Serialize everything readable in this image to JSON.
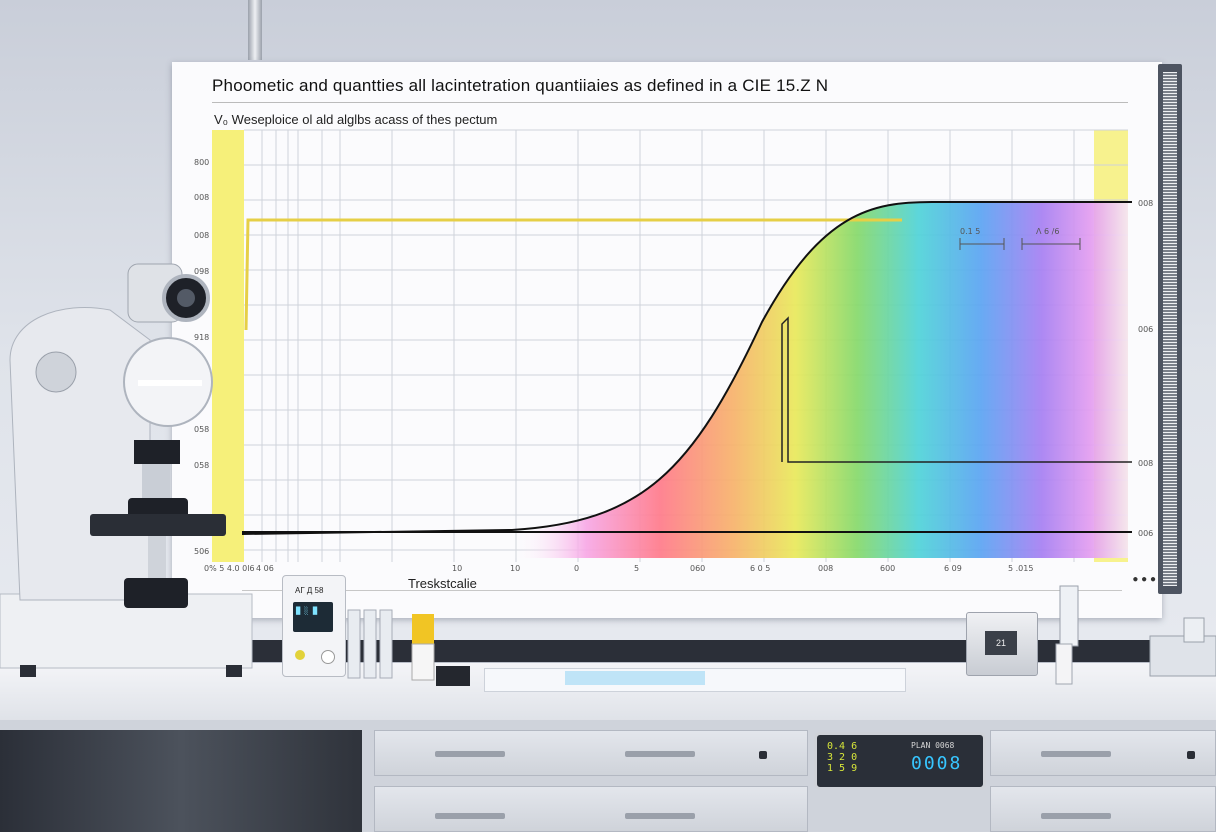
{
  "chart": {
    "title": "Phoometic and quantties all lacintetration quantiiaies as defined in a CIE 15.Z N",
    "subtitle": "V₀  Weseploice ol ald alglbs acass of thes pectum",
    "xlabel": "Treskstcalie",
    "y_ticks": [
      "800",
      "008",
      "008",
      "098",
      "918",
      "058",
      "058",
      "506"
    ],
    "x_ticks": [
      "0% 5  4.0 0l6",
      "4 06",
      "10",
      "10",
      "0",
      "5",
      "060",
      "6 0 5",
      "008",
      "600",
      "6 09",
      "5 .015"
    ],
    "right_ticks": [
      "008",
      "006",
      "008",
      "006"
    ],
    "annotations": [
      "0.1 5",
      "Ʌ 6 /6"
    ],
    "logo": "● ● ●"
  },
  "meter": {
    "label": "АГ Д 58",
    "screen": "█ ░ █"
  },
  "display": {
    "left_text": "0.4 6\n3 2 0\n1 5 9",
    "right_label": "PLAN 0068",
    "right_value": "0008"
  },
  "box_device": {
    "label": "21"
  },
  "colors": {
    "board": "#fbfbfd",
    "curve": "#111111",
    "yellow_band": "#f6f07a",
    "display_bg": "#2a2f38",
    "display_digits": "#37c6ff"
  }
}
